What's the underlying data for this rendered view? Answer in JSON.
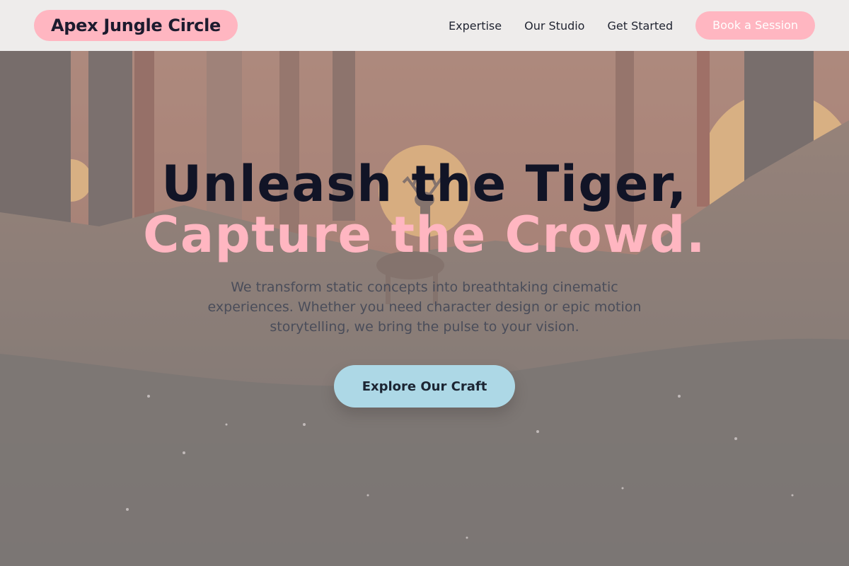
{
  "colors": {
    "accent_pink": "#ffb6c1",
    "accent_blue": "#add8e6",
    "heading_dark": "#111426",
    "header_bg": "#eeeceb"
  },
  "header": {
    "brand": "Apex Jungle Circle",
    "nav": [
      {
        "label": "Expertise"
      },
      {
        "label": "Our Studio"
      },
      {
        "label": "Get Started"
      }
    ],
    "cta_label": "Book a Session"
  },
  "hero": {
    "title_line1": "Unleash the Tiger,",
    "title_line2": "Capture the Crowd.",
    "subtitle": "We transform static concepts into breathtaking cinematic experiences. Whether you need character design or epic motion storytelling, we bring the pulse to your vision.",
    "button_label": "Explore Our Craft",
    "background_image": "forest-sunset-deer-illustration"
  }
}
